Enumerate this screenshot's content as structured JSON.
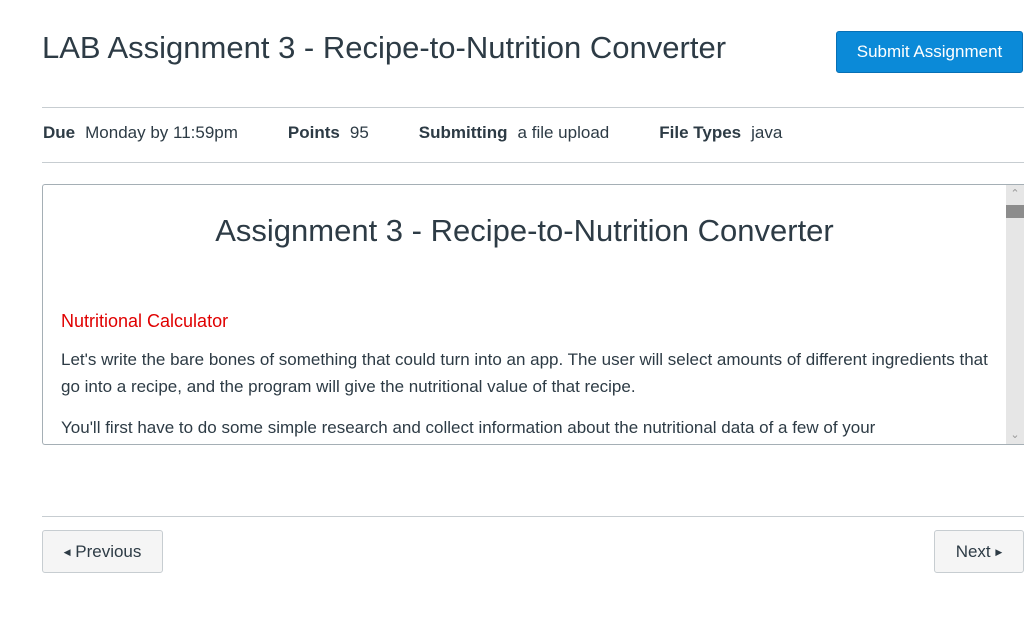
{
  "header": {
    "title": "LAB Assignment 3 - Recipe-to-Nutrition Converter",
    "submit_label": "Submit Assignment"
  },
  "details": [
    {
      "label": "Due",
      "value": "Monday by 11:59pm"
    },
    {
      "label": "Points",
      "value": "95"
    },
    {
      "label": "Submitting",
      "value": "a file upload"
    },
    {
      "label": "File Types",
      "value": "java"
    }
  ],
  "content": {
    "heading": "Assignment 3 - Recipe-to-Nutrition Converter",
    "subheading": "Nutritional Calculator",
    "paragraphs": [
      "Let's write the bare bones of something that could turn into an app.  The user will select amounts of different ingredients that go into a recipe, and the program will give the nutritional value of that recipe.",
      "You'll first have to do some simple research and collect information about the nutritional data of a few of your"
    ],
    "subheading_color": "#e00000"
  },
  "nav": {
    "previous_label": "Previous",
    "next_label": "Next",
    "prev_icon": "triangle-left",
    "next_icon": "triangle-right"
  },
  "colors": {
    "accent": "#0b8ad8"
  }
}
